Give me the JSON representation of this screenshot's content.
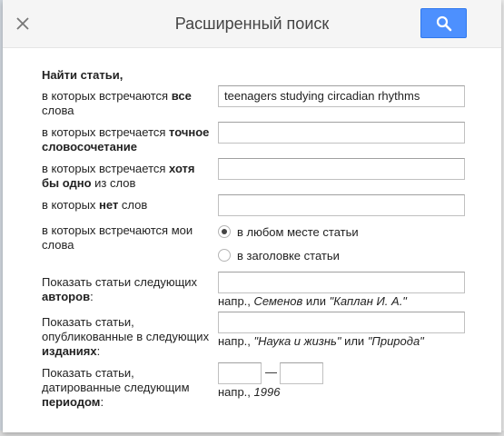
{
  "header": {
    "title": "Расширенный поиск",
    "accent_color": "#4d90fe",
    "close_icon": "close-icon",
    "search_icon": "search-icon"
  },
  "form": {
    "heading": "Найти статьи,",
    "all_words": {
      "label_pre": "в которых встречаются ",
      "label_bold": "все",
      "label_post": " слова",
      "value": "teenagers studying circadian rhythms"
    },
    "exact_phrase": {
      "label_pre": "в которых встречается ",
      "label_bold": "точное словосочетание",
      "value": ""
    },
    "any_words": {
      "label_pre": "в которых встречается ",
      "label_bold": "хотя бы одно",
      "label_post": " из слов",
      "value": ""
    },
    "none_words": {
      "label_pre": "в которых ",
      "label_bold": "нет",
      "label_post": " слов",
      "value": ""
    },
    "occurrence": {
      "label": "в которых встречаются мои слова",
      "options": [
        "в любом месте статьи",
        "в заголовке статьи"
      ],
      "selected": "в любом месте статьи"
    },
    "authors": {
      "label_pre": "Показать статьи следующих ",
      "label_bold": "авторов",
      "label_post": ":",
      "value": "",
      "hint_pre": "напр., ",
      "hint_ex1": "Семенов",
      "hint_mid": " или ",
      "hint_ex2": "\"Каплан И. А.\""
    },
    "publications": {
      "label_pre": "Показать статьи, опубликованные в следующих ",
      "label_bold": "изданиях",
      "label_post": ":",
      "value": "",
      "hint_pre": "напр., ",
      "hint_ex1": "\"Наука и жизнь\"",
      "hint_mid": " или ",
      "hint_ex2": "\"Природа\""
    },
    "period": {
      "label_pre": "Показать статьи, датированные следующим ",
      "label_bold": "периодом",
      "label_post": ":",
      "from": "",
      "to": "",
      "separator": "—",
      "hint_pre": "напр., ",
      "hint_ex": "1996"
    }
  }
}
